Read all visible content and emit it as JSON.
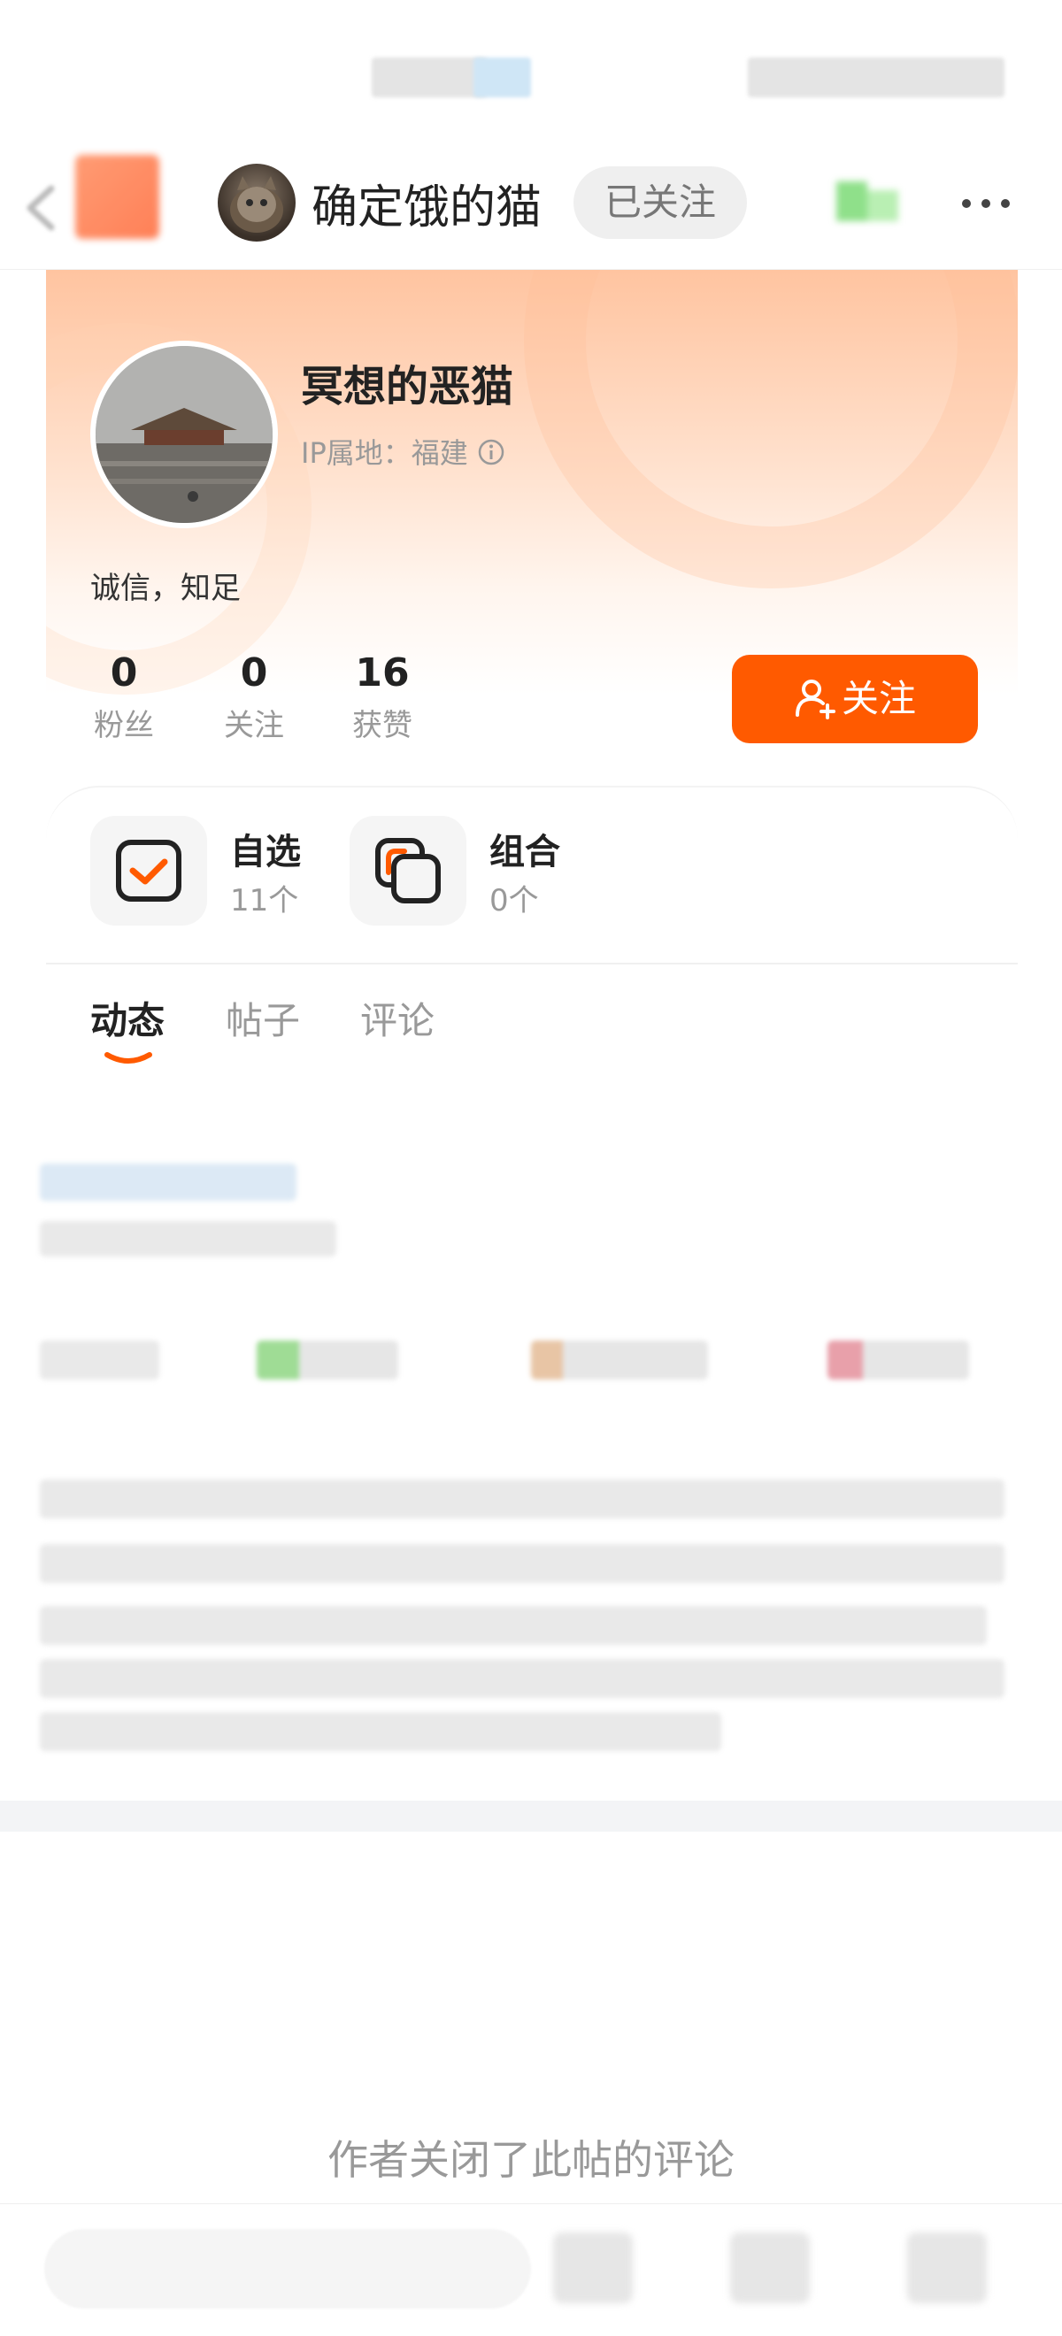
{
  "nav": {
    "author_name": "确定饿的猫",
    "followed_label": "已关注"
  },
  "profile": {
    "name": "冥想的恶猫",
    "ip_location": "IP属地：福建",
    "bio": "诚信，知足",
    "stats": [
      {
        "value": "0",
        "label": "粉丝"
      },
      {
        "value": "0",
        "label": "关注"
      },
      {
        "value": "16",
        "label": "获赞"
      }
    ],
    "follow_button": "关注"
  },
  "portfolio": {
    "items": [
      {
        "title": "自选",
        "count": "11个"
      },
      {
        "title": "组合",
        "count": "0个"
      }
    ]
  },
  "tabs": [
    {
      "label": "动态",
      "active": true
    },
    {
      "label": "帖子",
      "active": false
    },
    {
      "label": "评论",
      "active": false
    }
  ],
  "comments_closed_text": "作者关闭了此帖的评论",
  "colors": {
    "accent": "#ff5a00",
    "card_gradient_top": "#ffc4a0"
  }
}
